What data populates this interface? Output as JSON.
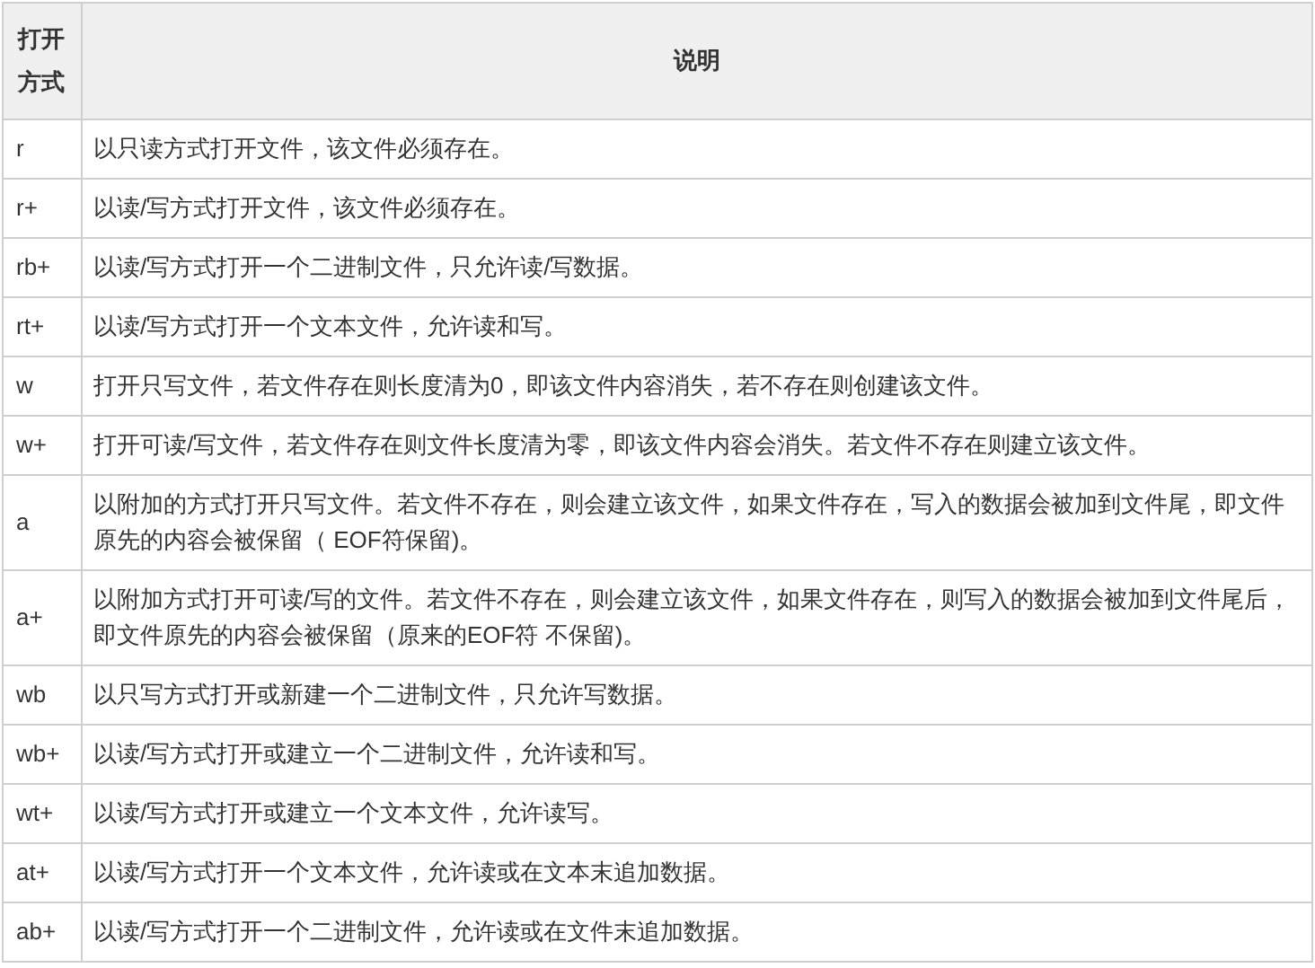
{
  "table": {
    "columns": [
      "打开方式",
      "说明"
    ],
    "rows": [
      {
        "mode": "r",
        "description": "以只读方式打开文件，该文件必须存在。"
      },
      {
        "mode": "r+",
        "description": "以读/写方式打开文件，该文件必须存在。"
      },
      {
        "mode": "rb+",
        "description": "以读/写方式打开一个二进制文件，只允许读/写数据。"
      },
      {
        "mode": "rt+",
        "description": "以读/写方式打开一个文本文件，允许读和写。"
      },
      {
        "mode": "w",
        "description": "打开只写文件，若文件存在则长度清为0，即该文件内容消失，若不存在则创建该文件。"
      },
      {
        "mode": "w+",
        "description": "打开可读/写文件，若文件存在则文件长度清为零，即该文件内容会消失。若文件不存在则建立该文件。"
      },
      {
        "mode": "a",
        "description": "以附加的方式打开只写文件。若文件不存在，则会建立该文件，如果文件存在，写入的数据会被加到文件尾，即文件原先的内容会被保留（ EOF符保留)。"
      },
      {
        "mode": "a+",
        "description": "以附加方式打开可读/写的文件。若文件不存在，则会建立该文件，如果文件存在，则写入的数据会被加到文件尾后，即文件原先的内容会被保留（原来的EOF符 不保留)。"
      },
      {
        "mode": "wb",
        "description": "以只写方式打开或新建一个二进制文件，只允许写数据。"
      },
      {
        "mode": "wb+",
        "description": "以读/写方式打开或建立一个二进制文件，允许读和写。"
      },
      {
        "mode": "wt+",
        "description": "以读/写方式打开或建立一个文本文件，允许读写。"
      },
      {
        "mode": "at+",
        "description": "以读/写方式打开一个文本文件，允许读或在文本末追加数据。"
      },
      {
        "mode": "ab+",
        "description": "以读/写方式打开一个二进制文件，允许读或在文件末追加数据。"
      }
    ]
  }
}
